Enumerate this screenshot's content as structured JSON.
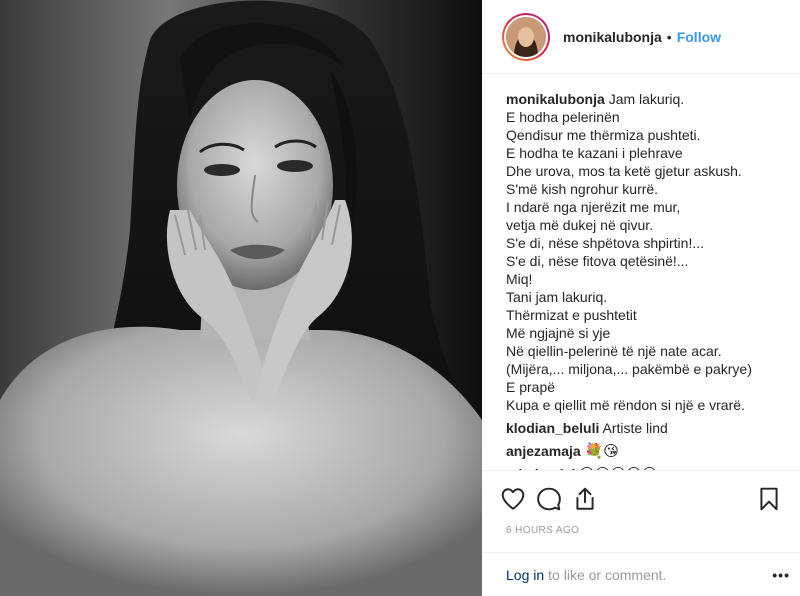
{
  "post": {
    "author": "monikalubonja",
    "separator": "•",
    "follow_label": "Follow",
    "caption": "Jam lakuriq.\nE hodha pelerinën\nQendisur me thërmiza pushteti.\nE hodha te kazani i plehrave\nDhe urova, mos ta ketë gjetur askush.\nS'më kish ngrohur kurrë.\nI ndarë nga njerëzit me mur,\nvetja më dukej në qivur.\nS'e di, nëse shpëtova shpirtin!...\nS'e di, nëse fitova qetësinë!...\nMiq!\nTani jam lakuriq.\nThërmizat e pushtetit\nMë ngjajnë si yje\nNë qiellin-pelerinë të një nate acar.\n(Mijëra,... miljona,... pakëmbë e pakrye)\nE prapë\nKupa e qiellit më rëndon si një e vrarë.",
    "timestamp": "6 HOURS AGO"
  },
  "comments": [
    {
      "user": "klodian_beluli",
      "text": "Artiste lind"
    },
    {
      "user": "anjezamaja",
      "text": "💐😘"
    },
    {
      "user": "mitakonisi",
      "text": "😍😍😍😍😍"
    }
  ],
  "actions": {
    "like": "heart-icon",
    "comment": "comment-icon",
    "share": "share-icon",
    "save": "bookmark-icon"
  },
  "footer": {
    "login_link": "Log in",
    "login_rest": "to like or comment.",
    "more_label": "•••"
  },
  "colors": {
    "follow": "#3897f0",
    "link": "#003569",
    "muted": "#999999",
    "border": "#efefef"
  }
}
